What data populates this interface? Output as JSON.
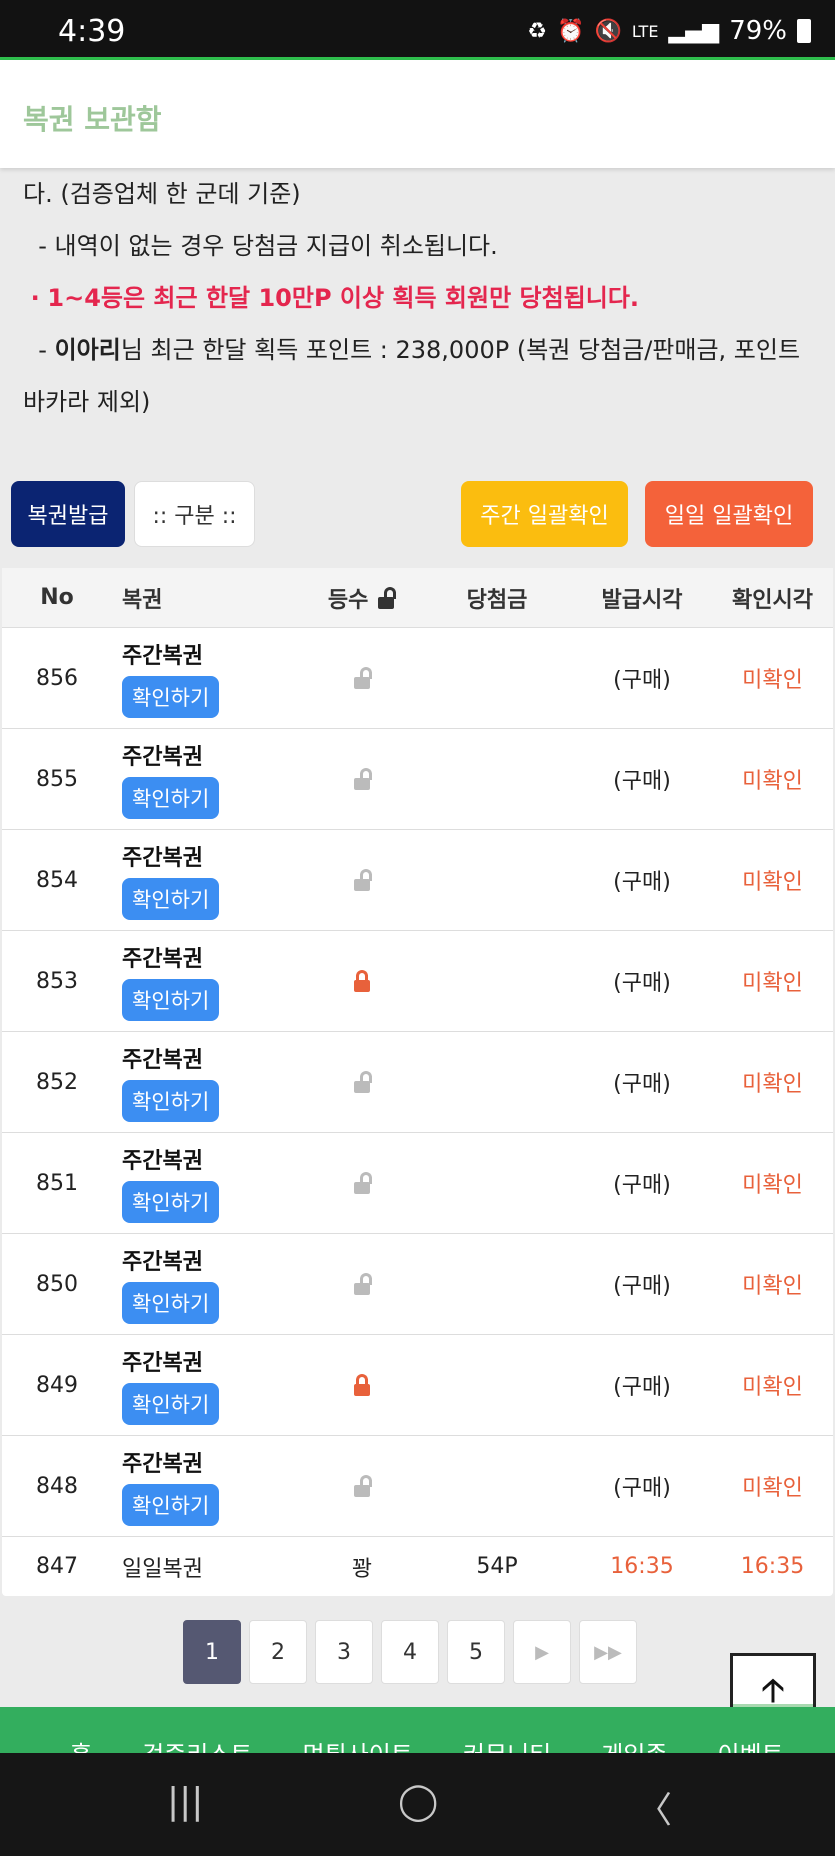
{
  "statusbar": {
    "time": "4:39",
    "net": "LTE",
    "battery": "79%"
  },
  "header": {
    "title": "복권 보관함"
  },
  "notice": {
    "line1": "다. (검증업체 한 군데 기준)",
    "line2": "- 내역이 없는 경우 당첨금 지급이 취소됩니다.",
    "line3_bullet": "·",
    "line3": "1~4등은 최근 한달 10만P 이상 획득 회원만 당첨됩니다.",
    "line4_prefix": "-",
    "line4_user": "이아리",
    "line4_rest": "님 최근 한달 획득 포인트 : 238,000P (복권 당첨금/판매금, 포인트",
    "line5": "바카라 제외)"
  },
  "toolbar": {
    "issue": "복권발급",
    "category": ":: 구분 ::",
    "weekly_confirm": "주간 일괄확인",
    "daily_confirm": "일일 일괄확인"
  },
  "table": {
    "headers": {
      "no": "No",
      "ticket": "복권",
      "rank": "등수",
      "prize": "당첨금",
      "issued": "발급시각",
      "confirmed": "확인시각"
    },
    "check_label": "확인하기",
    "rows": [
      {
        "no": "856",
        "name": "주간복권",
        "lock": "open",
        "prize": "",
        "issued": "(구매)",
        "confirmed": "미확인"
      },
      {
        "no": "855",
        "name": "주간복권",
        "lock": "open",
        "prize": "",
        "issued": "(구매)",
        "confirmed": "미확인"
      },
      {
        "no": "854",
        "name": "주간복권",
        "lock": "open",
        "prize": "",
        "issued": "(구매)",
        "confirmed": "미확인"
      },
      {
        "no": "853",
        "name": "주간복권",
        "lock": "closed",
        "prize": "",
        "issued": "(구매)",
        "confirmed": "미확인"
      },
      {
        "no": "852",
        "name": "주간복권",
        "lock": "open",
        "prize": "",
        "issued": "(구매)",
        "confirmed": "미확인"
      },
      {
        "no": "851",
        "name": "주간복권",
        "lock": "open",
        "prize": "",
        "issued": "(구매)",
        "confirmed": "미확인"
      },
      {
        "no": "850",
        "name": "주간복권",
        "lock": "open",
        "prize": "",
        "issued": "(구매)",
        "confirmed": "미확인"
      },
      {
        "no": "849",
        "name": "주간복권",
        "lock": "closed",
        "prize": "",
        "issued": "(구매)",
        "confirmed": "미확인"
      },
      {
        "no": "848",
        "name": "주간복권",
        "lock": "open",
        "prize": "",
        "issued": "(구매)",
        "confirmed": "미확인"
      }
    ],
    "last_row": {
      "no": "847",
      "name": "일일복권",
      "rank": "꽝",
      "prize": "54P",
      "issued": "16:35",
      "confirmed": "16:35"
    }
  },
  "pager": {
    "pages": [
      "1",
      "2",
      "3",
      "4",
      "5"
    ],
    "next": "▶",
    "last": "▶▶"
  },
  "totop": {
    "arrow": "🡡"
  },
  "footer_nav": [
    "홈",
    "검증리스트",
    "먹튀사이트",
    "커뮤니티",
    "게임존",
    "이벤트"
  ],
  "navbar": {
    "recents": "|||",
    "home": "◯",
    "back": "〈"
  },
  "colors": {
    "accent_green": "#33ae5e",
    "unconfirmed": "#e8613b",
    "issue_btn": "#0b2472"
  }
}
